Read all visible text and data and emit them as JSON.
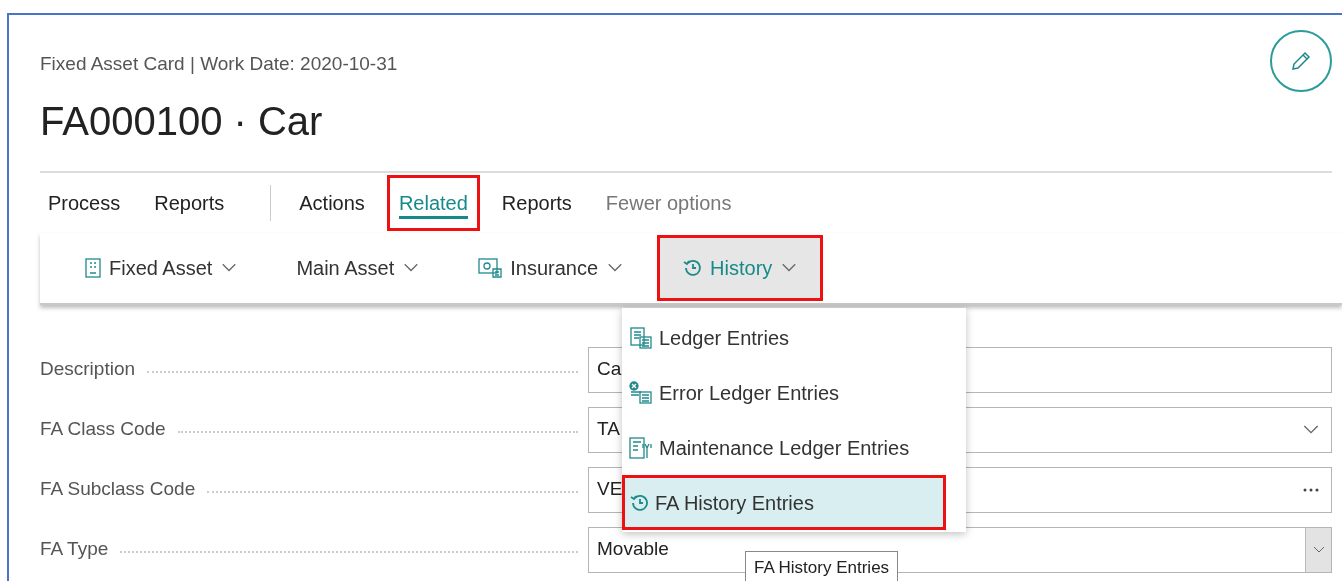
{
  "header": {
    "caption": "Fixed Asset Card | Work Date: 2020-10-31",
    "title": "FA000100 · Car"
  },
  "tabs": [
    {
      "label": "Process",
      "selected": false,
      "kind": "promoted",
      "highlighted": false
    },
    {
      "label": "Reports",
      "selected": false,
      "kind": "promoted",
      "highlighted": false
    },
    {
      "label": "Actions",
      "selected": false,
      "kind": "menu",
      "highlighted": false
    },
    {
      "label": "Related",
      "selected": true,
      "kind": "menu",
      "highlighted": true
    },
    {
      "label": "Reports",
      "selected": false,
      "kind": "menu",
      "highlighted": false
    },
    {
      "label": "Fewer options",
      "selected": false,
      "kind": "toggle",
      "highlighted": false
    }
  ],
  "actions": [
    {
      "label": "Fixed Asset",
      "kind": "building",
      "open": false,
      "highlighted": false
    },
    {
      "label": "Main Asset",
      "kind": "plain",
      "open": false,
      "highlighted": false
    },
    {
      "label": "Insurance",
      "kind": "insurance",
      "open": false,
      "highlighted": false
    },
    {
      "label": "History",
      "kind": "history",
      "open": true,
      "highlighted": true
    }
  ],
  "menu": [
    {
      "label": "Ledger Entries",
      "kind": "ledger",
      "selected": false,
      "highlighted": false
    },
    {
      "label": "Error Ledger Entries",
      "kind": "error",
      "selected": false,
      "highlighted": false
    },
    {
      "label": "Maintenance Ledger Entries",
      "kind": "maintenance",
      "selected": false,
      "highlighted": false
    },
    {
      "label": "FA History Entries",
      "kind": "history",
      "selected": true,
      "highlighted": true
    }
  ],
  "tooltip": "FA History Entries",
  "fields": [
    {
      "label": "Description",
      "value": "Ca",
      "kind": "text"
    },
    {
      "label": "FA Class Code",
      "value": "TA",
      "kind": "select"
    },
    {
      "label": "FA Subclass Code",
      "value": "VE",
      "kind": "lookup"
    },
    {
      "label": "FA Type",
      "value": "Movable",
      "kind": "dropdown"
    }
  ]
}
